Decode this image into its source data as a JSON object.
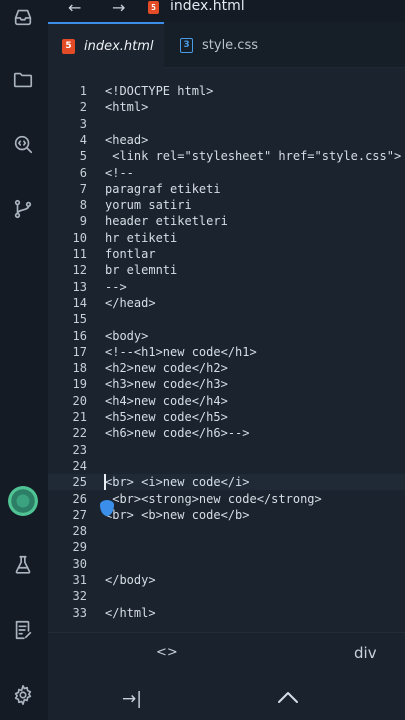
{
  "topbar": {
    "back": "←",
    "forward": "→",
    "filename": "index.html"
  },
  "tabs": [
    {
      "label": "index.html",
      "type": "HTML"
    },
    {
      "label": "style.css",
      "type": "CSS"
    }
  ],
  "editor": {
    "lines": [
      {
        "n": "1",
        "text": "<!DOCTYPE html>"
      },
      {
        "n": "2",
        "text": "<html>"
      },
      {
        "n": "3",
        "text": ""
      },
      {
        "n": "4",
        "text": "<head>"
      },
      {
        "n": "5",
        "text": " <link rel=\"stylesheet\" href=\"style.css\">"
      },
      {
        "n": "6",
        "text": "<!--"
      },
      {
        "n": "7",
        "text": "paragraf etiketi"
      },
      {
        "n": "8",
        "text": "yorum satiri"
      },
      {
        "n": "9",
        "text": "header etiketleri"
      },
      {
        "n": "10",
        "text": "hr etiketi"
      },
      {
        "n": "11",
        "text": "fontlar"
      },
      {
        "n": "12",
        "text": "br elemnti"
      },
      {
        "n": "13",
        "text": "-->"
      },
      {
        "n": "14",
        "text": "</head>"
      },
      {
        "n": "15",
        "text": ""
      },
      {
        "n": "16",
        "text": "<body>"
      },
      {
        "n": "17",
        "text": "<!--<h1>new code</h1>"
      },
      {
        "n": "18",
        "text": "<h2>new code</h2>"
      },
      {
        "n": "19",
        "text": "<h3>new code</h3>"
      },
      {
        "n": "20",
        "text": "<h4>new code</h4>"
      },
      {
        "n": "21",
        "text": "<h5>new code</h5>"
      },
      {
        "n": "22",
        "text": "<h6>new code</h6>-->"
      },
      {
        "n": "23",
        "text": ""
      },
      {
        "n": "24",
        "text": ""
      },
      {
        "n": "25",
        "text": "<br> <i>new code</i>"
      },
      {
        "n": "26",
        "text": " <br><strong>new code</strong>"
      },
      {
        "n": "27",
        "text": "<br> <b>new code</b>"
      },
      {
        "n": "28",
        "text": ""
      },
      {
        "n": "29",
        "text": ""
      },
      {
        "n": "30",
        "text": ""
      },
      {
        "n": "31",
        "text": "</body>"
      },
      {
        "n": "32",
        "text": ""
      },
      {
        "n": "33",
        "text": "</html>"
      }
    ],
    "current_line": "25"
  },
  "keys": {
    "brackets": "<>",
    "div": "div",
    "tab": "→|",
    "up": "^"
  },
  "icons": {
    "activity": [
      "inbox-icon",
      "folder-icon",
      "search-icon",
      "git-branch-icon",
      "avatar",
      "flask-icon",
      "notes-icon",
      "gear-icon"
    ]
  },
  "colors": {
    "accent": "#3b8eea",
    "html_icon": "#e34c26",
    "css_icon": "#4a9be6"
  }
}
